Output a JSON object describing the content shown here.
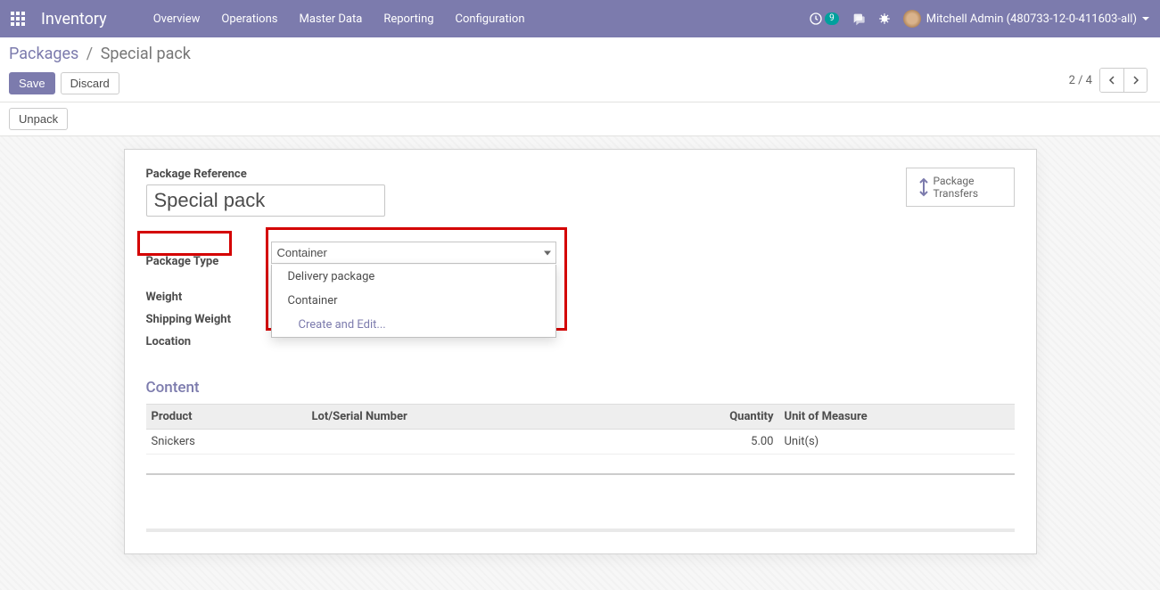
{
  "nav": {
    "brand": "Inventory",
    "menu": [
      "Overview",
      "Operations",
      "Master Data",
      "Reporting",
      "Configuration"
    ],
    "notification_count": "9",
    "user_name": "Mitchell Admin (480733-12-0-411603-all)"
  },
  "breadcrumbs": {
    "root": "Packages",
    "current": "Special pack"
  },
  "toolbar": {
    "save": "Save",
    "discard": "Discard"
  },
  "pager": {
    "text": "2 / 4"
  },
  "actions": {
    "unpack": "Unpack"
  },
  "button_box": {
    "line1": "Package",
    "line2": "Transfers"
  },
  "form": {
    "pkg_ref_label": "Package Reference",
    "pkg_ref_value": "Special pack",
    "labels": {
      "package_type": "Package Type",
      "weight": "Weight",
      "shipping_weight": "Shipping Weight",
      "location": "Location"
    },
    "package_type_value": "Container",
    "dropdown": {
      "opt1": "Delivery package",
      "opt2": "Container",
      "opt3": "Create and Edit..."
    }
  },
  "content": {
    "title": "Content",
    "headers": {
      "product": "Product",
      "lot": "Lot/Serial Number",
      "quantity": "Quantity",
      "uom": "Unit of Measure"
    },
    "rows": [
      {
        "product": "Snickers",
        "lot": "",
        "quantity": "5.00",
        "uom": "Unit(s)"
      }
    ]
  }
}
